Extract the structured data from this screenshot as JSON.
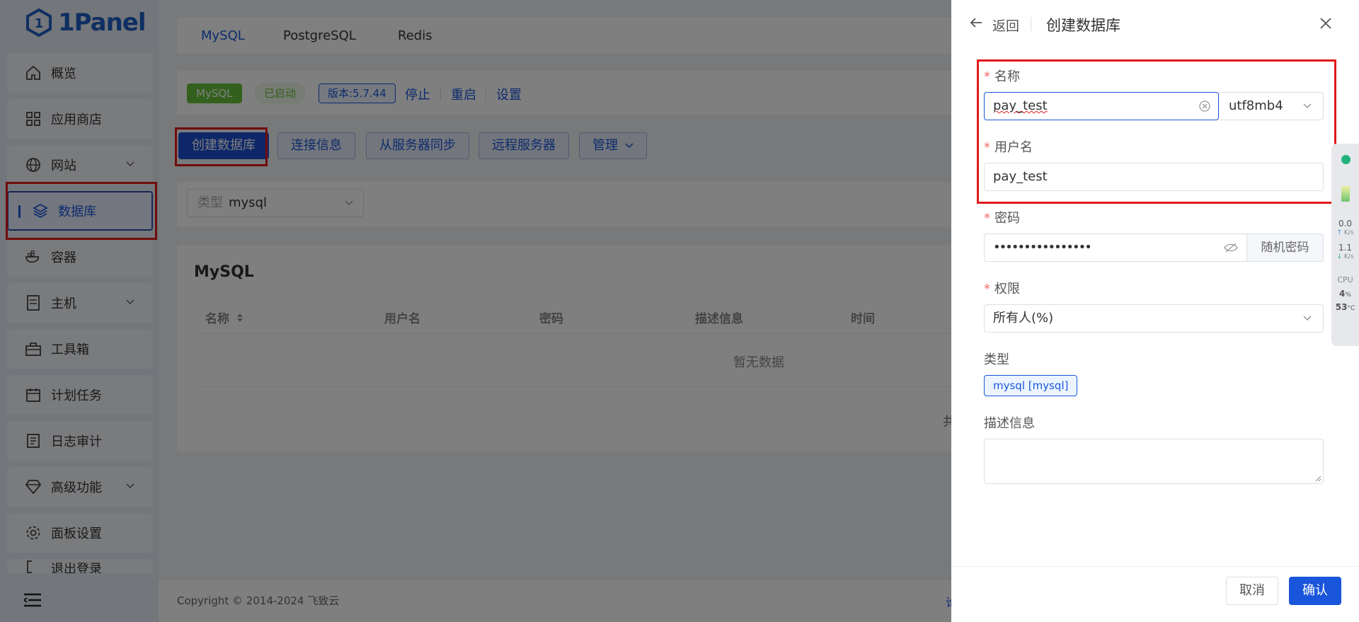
{
  "app": {
    "logo_text": "1Panel"
  },
  "sidebar": {
    "items": [
      {
        "label": "概览",
        "icon": "home-icon"
      },
      {
        "label": "应用商店",
        "icon": "grid-icon"
      },
      {
        "label": "网站",
        "icon": "globe-icon",
        "expandable": true
      },
      {
        "label": "数据库",
        "icon": "layers-icon",
        "active": true
      },
      {
        "label": "容器",
        "icon": "docker-icon"
      },
      {
        "label": "主机",
        "icon": "server-icon",
        "expandable": true
      },
      {
        "label": "工具箱",
        "icon": "toolbox-icon"
      },
      {
        "label": "计划任务",
        "icon": "calendar-icon"
      },
      {
        "label": "日志审计",
        "icon": "log-icon"
      },
      {
        "label": "高级功能",
        "icon": "diamond-icon",
        "expandable": true
      },
      {
        "label": "面板设置",
        "icon": "gear-icon"
      },
      {
        "label": "退出登录",
        "icon": "logout-icon"
      }
    ]
  },
  "db_tabs": [
    "MySQL",
    "PostgreSQL",
    "Redis"
  ],
  "status": {
    "app_tag": "MySQL",
    "running": "已启动",
    "version": "版本:5.7.44",
    "actions": [
      "停止",
      "重启",
      "设置"
    ]
  },
  "toolbar": {
    "create": "创建数据库",
    "conn_info": "连接信息",
    "sync": "从服务器同步",
    "remote": "远程服务器",
    "manage": "管理"
  },
  "filter": {
    "prefix": "类型",
    "value": "mysql"
  },
  "table": {
    "title": "MySQL",
    "columns": [
      "名称",
      "用户名",
      "密码",
      "描述信息",
      "时间"
    ],
    "empty_text": "暂无数据",
    "pager_partial": "共"
  },
  "footer": {
    "copyright": "Copyright © 2014-2024 飞致云",
    "tail": "论"
  },
  "drawer": {
    "back": "返回",
    "title": "创建数据库",
    "fields": {
      "name_label": "名称",
      "name_value": "pay_test",
      "charset": "utf8mb4",
      "username_label": "用户名",
      "username_value": "pay_test",
      "password_label": "密码",
      "password_value": "••••••••••••••••",
      "random_pw": "随机密码",
      "permission_label": "权限",
      "permission_value": "所有人(%)",
      "type_label": "类型",
      "type_tag": "mysql [mysql]",
      "desc_label": "描述信息"
    },
    "cancel": "取消",
    "confirm": "确认"
  },
  "monitor": {
    "up_speed": "0.0",
    "up_unit": "K/s",
    "down_speed": "1.1",
    "down_unit": "K/s",
    "cpu_label": "CPU",
    "cpu_value": "4",
    "cpu_unit": "%",
    "temp_value": "53",
    "temp_unit": "°C"
  },
  "colors": {
    "primary": "#1a56db",
    "highlight": "#e01919",
    "success": "#67c23a"
  }
}
